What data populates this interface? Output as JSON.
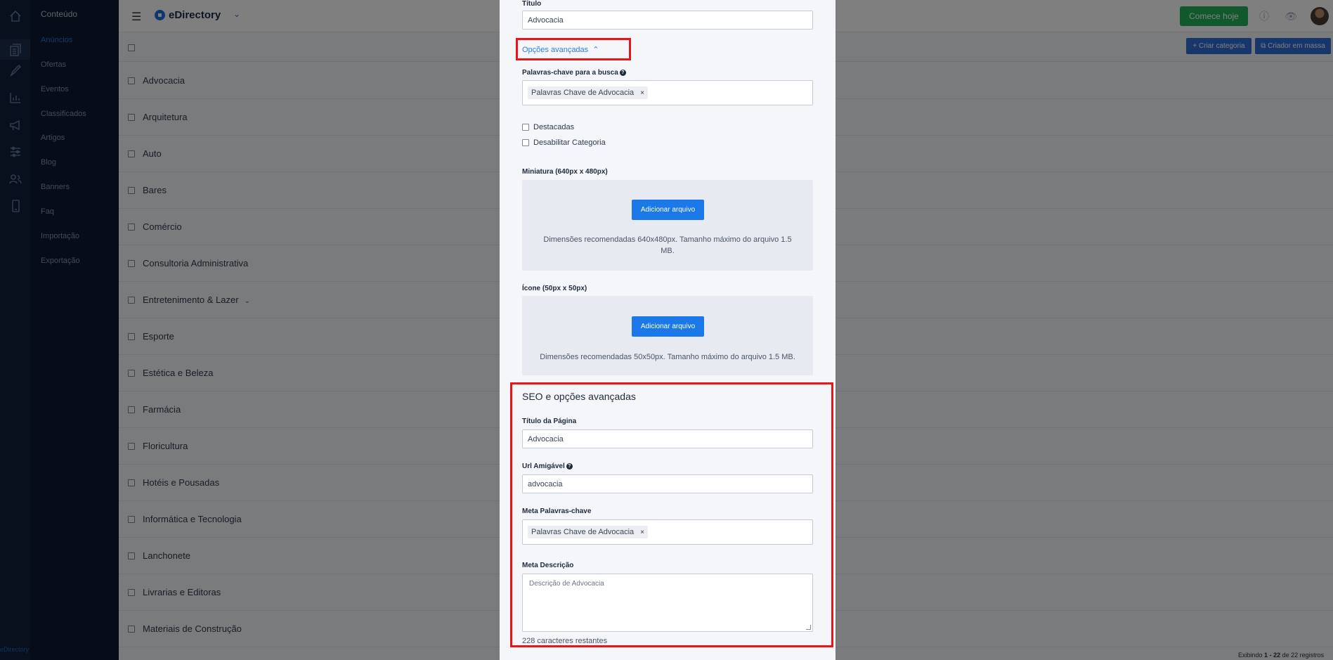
{
  "app": {
    "name": "eDirectory",
    "menu_title": "Conteúdo",
    "menu_items": [
      "Anúncios",
      "Ofertas",
      "Eventos",
      "Classificados",
      "Artigos",
      "Blog",
      "Banners",
      "Faq",
      "Importação",
      "Exportação"
    ],
    "rail_icons": [
      "home-icon",
      "pages-icon",
      "brush-icon",
      "chart-icon",
      "megaphone-icon",
      "sliders-icon",
      "users-icon",
      "mobile-icon"
    ],
    "rail_footer": "eDirectory",
    "start_button": "Comece hoje",
    "accent": "#2f6fd6"
  },
  "toolbar": {
    "create_category": "Criar categoria",
    "bulk_creator": "Criador em massa"
  },
  "categories": [
    "Advocacia",
    "Arquitetura",
    "Auto",
    "Bares",
    "Comércio",
    "Consultoria Administrativa",
    "Entretenimento & Lazer",
    "Esporte",
    "Estética e Beleza",
    "Farmácia",
    "Floricultura",
    "Hotéis e Pousadas",
    "Informática e Tecnologia",
    "Lanchonete",
    "Livrarias e Editoras",
    "Materiais de Construção"
  ],
  "footer": {
    "prefix": "Exibindo",
    "range_start": "1",
    "sep": "-",
    "range_end": "22",
    "suffix": "de 22 registros"
  },
  "modal": {
    "title_label": "Título",
    "title_value": "Advocacia",
    "advanced_toggle": "Opções avançadas",
    "keywords_label": "Palavras-chave para a busca",
    "keywords_tag": "Palavras Chave de Advocacia",
    "featured_label": "Destacadas",
    "disable_label": "Desabilitar Categoria",
    "thumb_label": "Miniatura (640px x 480px)",
    "thumb_button": "Adicionar arquivo",
    "thumb_hint": "Dimensões recomendadas 640x480px. Tamanho máximo do arquivo 1.5 MB.",
    "icon_label": "Ícone (50px x 50px)",
    "icon_button": "Adicionar arquivo",
    "icon_hint": "Dimensões recomendadas 50x50px. Tamanho máximo do arquivo 1.5 MB.",
    "seo_title": "SEO e opções avançadas",
    "page_title_label": "Título da Página",
    "page_title_value": "Advocacia",
    "url_label": "Url Amigável",
    "url_value": "advocacia",
    "meta_keywords_label": "Meta Palavras-chave",
    "meta_keywords_tag": "Palavras Chave de Advocacia",
    "meta_desc_label": "Meta Descrição",
    "meta_desc_value": "Descrição de Advocacia",
    "chars_remaining": "228 caracteres restantes",
    "highlight_color": "#e8161b"
  }
}
